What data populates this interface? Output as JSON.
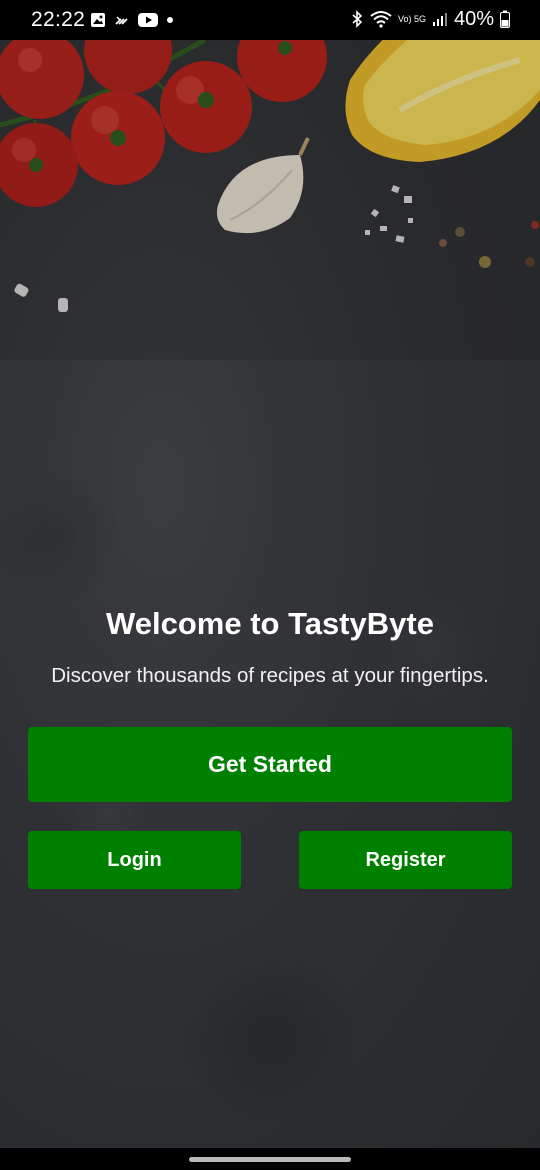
{
  "status_bar": {
    "time": "22:22",
    "battery": "40%",
    "left_icons": [
      "gallery-icon",
      "missed-call-icon",
      "youtube-icon",
      "notification-dot-icon"
    ],
    "right_icons": [
      "bluetooth-icon",
      "wifi-icon",
      "volte-5g-icon",
      "signal-icon",
      "battery-icon"
    ],
    "network_label": "Vo) 5G"
  },
  "welcome": {
    "title": "Welcome to TastyByte",
    "subtitle": "Discover thousands of recipes at your fingertips."
  },
  "actions": {
    "get_started": "Get Started",
    "login": "Login",
    "register": "Register"
  },
  "colors": {
    "primary_green": "#008000",
    "background_slate": "#2f3134",
    "text": "#ffffff"
  }
}
